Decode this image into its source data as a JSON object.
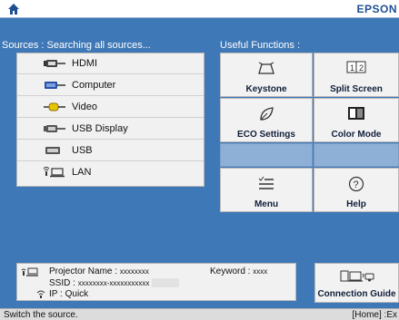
{
  "header": {
    "brand": "EPSON"
  },
  "sources": {
    "title": "Sources : Searching all sources...",
    "items": [
      {
        "icon": "hdmi-port-icon",
        "label": "HDMI"
      },
      {
        "icon": "computer-port-icon",
        "label": "Computer"
      },
      {
        "icon": "video-port-icon",
        "label": "Video"
      },
      {
        "icon": "usb-display-port-icon",
        "label": "USB Display"
      },
      {
        "icon": "usb-port-icon",
        "label": "USB"
      },
      {
        "icon": "lan-icon",
        "label": "LAN"
      }
    ]
  },
  "useful": {
    "title": "Useful Functions :",
    "buttons": [
      {
        "icon": "keystone-icon",
        "label": "Keystone"
      },
      {
        "icon": "split-screen-icon",
        "label": "Split Screen"
      },
      {
        "icon": "eco-leaf-icon",
        "label": "ECO Settings"
      },
      {
        "icon": "color-mode-icon",
        "label": "Color Mode"
      },
      {
        "icon": "menu-icon",
        "label": "Menu"
      },
      {
        "icon": "help-icon",
        "label": "Help"
      }
    ]
  },
  "network": {
    "projector_name_label": "Projector Name :",
    "projector_name_value": "xxxxxxxx",
    "keyword_label": "Keyword :",
    "keyword_value": "xxxx",
    "ssid_label": "SSID :",
    "ssid_value": "xxxxxxxx-xxxxxxxxxxx",
    "ip_label": "IP :",
    "ip_value": "Quick"
  },
  "connection_guide": {
    "label": "Connection Guide"
  },
  "status": {
    "hint": "Switch the source.",
    "key_hint": "[Home] :Ex"
  },
  "colors": {
    "background": "#3f78b7",
    "panel": "#f1f1f1",
    "brand": "#1f4f93"
  }
}
